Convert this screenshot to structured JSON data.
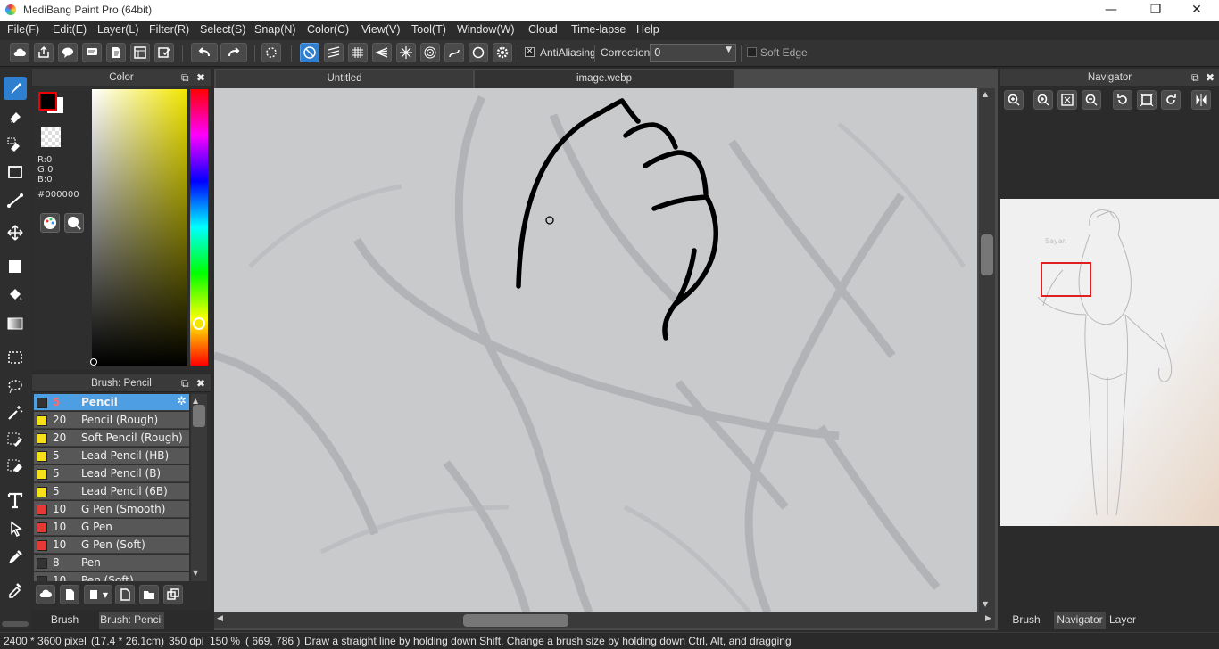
{
  "window": {
    "title": "MediBang Paint Pro (64bit)",
    "minimize_glyph": "—",
    "restore_glyph": "❐",
    "close_glyph": "✕"
  },
  "menu": [
    "File(F)",
    "Edit(E)",
    "Layer(L)",
    "Filter(R)",
    "Select(S)",
    "Snap(N)",
    "Color(C)",
    "View(V)",
    "Tool(T)",
    "Window(W)",
    "Cloud",
    "Time-lapse",
    "Help"
  ],
  "toolbar": {
    "antialiasing_label": "AntiAliasing",
    "antialiasing_checked": true,
    "correction_label": "Correction",
    "correction_value": "0",
    "soft_edge_label": "Soft Edge",
    "soft_edge_checked": false
  },
  "color_panel": {
    "title": "Color",
    "r": "R:0",
    "g": "G:0",
    "b": "B:0",
    "hex": "#000000",
    "foreground": "#000000",
    "background": "#ffffff",
    "hue_color": "#f2e600"
  },
  "brush_panel": {
    "title": "Brush: Pencil",
    "items": [
      {
        "size": "5",
        "name": "Pencil",
        "color": "#333333",
        "selected": true
      },
      {
        "size": "20",
        "name": "Pencil (Rough)",
        "color": "#f5e01a",
        "selected": false
      },
      {
        "size": "20",
        "name": "Soft Pencil (Rough)",
        "color": "#f5e01a",
        "selected": false
      },
      {
        "size": "5",
        "name": "Lead Pencil (HB)",
        "color": "#f5e01a",
        "selected": false
      },
      {
        "size": "5",
        "name": "Lead Pencil (B)",
        "color": "#f5e01a",
        "selected": false
      },
      {
        "size": "5",
        "name": "Lead Pencil (6B)",
        "color": "#f5e01a",
        "selected": false
      },
      {
        "size": "10",
        "name": "G Pen (Smooth)",
        "color": "#e53935",
        "selected": false
      },
      {
        "size": "10",
        "name": "G Pen",
        "color": "#e53935",
        "selected": false
      },
      {
        "size": "10",
        "name": "G Pen (Soft)",
        "color": "#e53935",
        "selected": false
      },
      {
        "size": "8",
        "name": "Pen",
        "color": "#333333",
        "selected": false
      },
      {
        "size": "10",
        "name": "Pen (Soft)",
        "color": "#333333",
        "selected": false
      }
    ],
    "bottom_tabs": [
      "Brush Control",
      "Brush: Pencil"
    ]
  },
  "documents": {
    "tabs": [
      "Untitled",
      "image.webp"
    ],
    "active_tab": "image.webp"
  },
  "navigator": {
    "title": "Navigator",
    "bottom_tabs": [
      "Brush Size",
      "Navigator",
      "Layer"
    ],
    "active_tab": "Navigator",
    "thumbnail_label": "Sayan"
  },
  "status": {
    "size": "2400 * 3600 pixel",
    "physical": "(17.4 * 26.1cm)",
    "dpi": "350 dpi",
    "zoom": "150 %",
    "coords": "( 669, 786 )",
    "hint": "Draw a straight line by holding down Shift, Change a brush size by holding down Ctrl, Alt, and dragging"
  }
}
